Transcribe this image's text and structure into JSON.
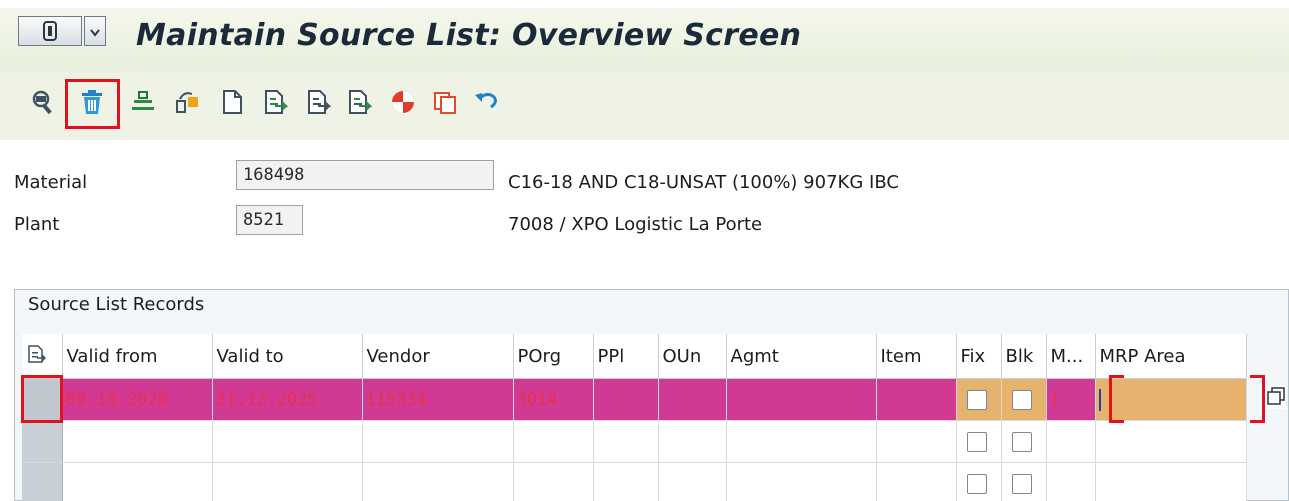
{
  "window": {
    "title": "Maintain Source List: Overview Screen"
  },
  "toolbar": {
    "icons": [
      "display-icon",
      "delete-icon",
      "balance-icon",
      "generate-records-icon",
      "new-entries-icon",
      "select-all-icon",
      "deselect-all-icon",
      "select-block-icon",
      "check-icon",
      "copy-icon",
      "undo-icon"
    ]
  },
  "header": {
    "material_label": "Material",
    "material_value": "168498",
    "material_desc": "C16-18 AND C18-UNSAT (100%) 907KG IBC",
    "plant_label": "Plant",
    "plant_value": "8521",
    "plant_desc": "7008 / XPO Logistic La Porte"
  },
  "records": {
    "group_title": "Source List Records",
    "columns": [
      "Valid from",
      "Valid to",
      "Vendor",
      "POrg",
      "PPl",
      "OUn",
      "Agmt",
      "Item",
      "Fix",
      "Blk",
      "M...",
      "MRP Area"
    ],
    "rows": [
      {
        "valid_from": "09.10.2020",
        "valid_to": "31.12.2025",
        "vendor": "115334",
        "porg": "3014",
        "ppl": "",
        "oun": "",
        "agmt": "",
        "item": "",
        "fix": false,
        "blk": false,
        "m": "1",
        "mrp_area": ""
      },
      {
        "valid_from": "",
        "valid_to": "",
        "vendor": "",
        "porg": "",
        "ppl": "",
        "oun": "",
        "agmt": "",
        "item": "",
        "fix": false,
        "blk": false,
        "m": "",
        "mrp_area": ""
      },
      {
        "valid_from": "",
        "valid_to": "",
        "vendor": "",
        "porg": "",
        "ppl": "",
        "oun": "",
        "agmt": "",
        "item": "",
        "fix": false,
        "blk": false,
        "m": "",
        "mrp_area": ""
      }
    ]
  },
  "colors": {
    "highlight_row": "#d03a95",
    "highlight_text": "#e8304a",
    "entry_cell": "#e5b36e",
    "annotation_red": "#e3111b"
  }
}
